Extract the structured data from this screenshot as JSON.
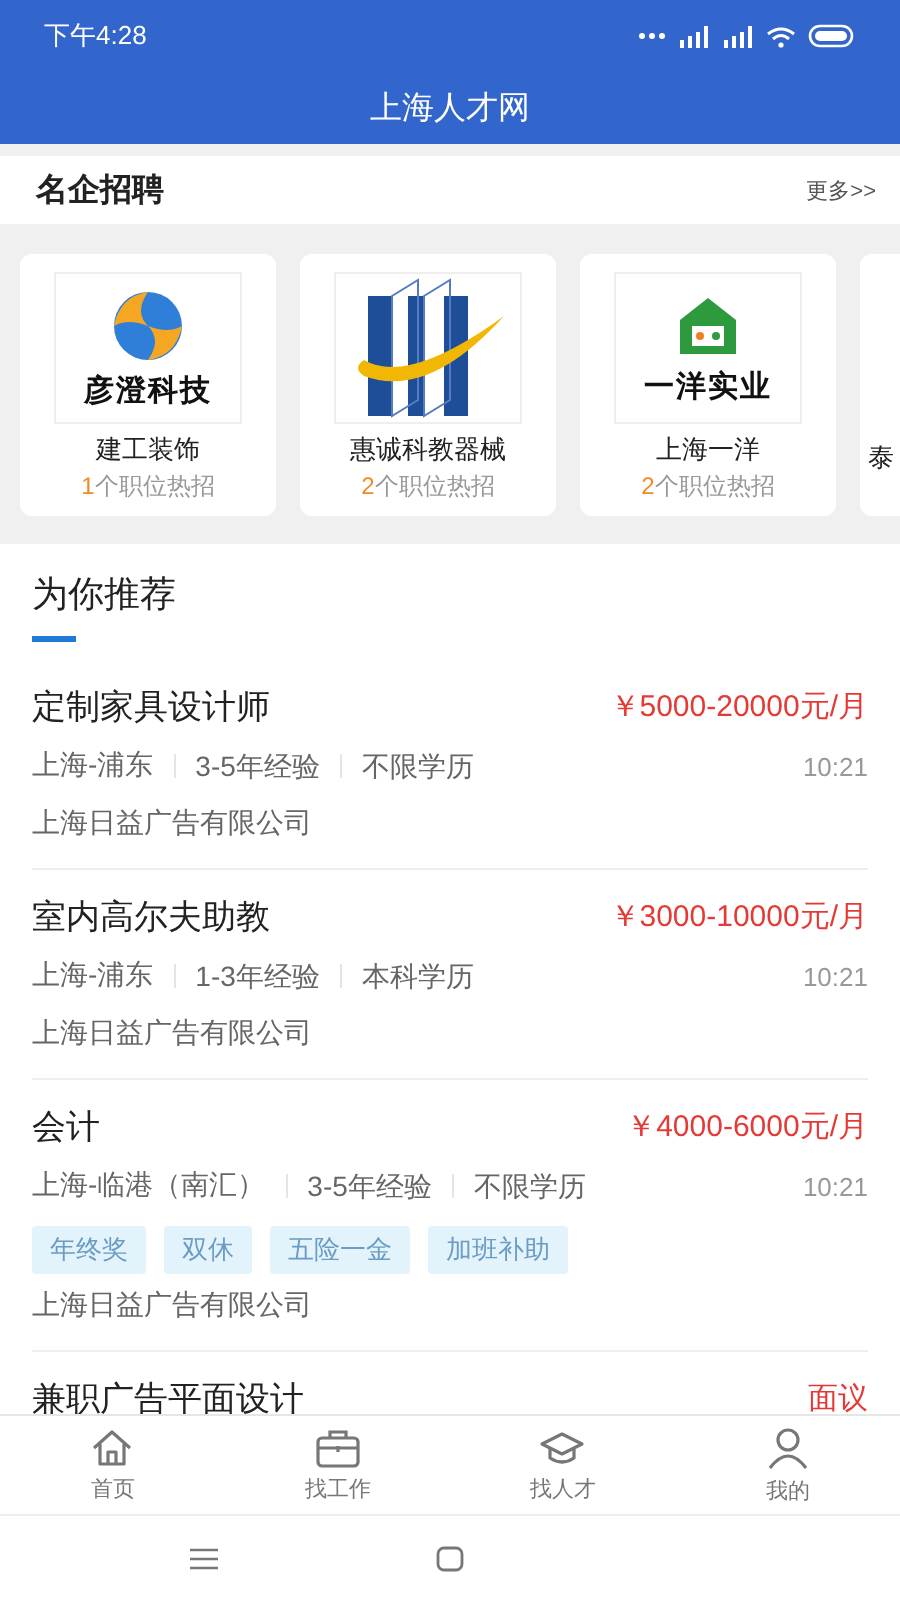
{
  "status_bar": {
    "time": "下午4:28"
  },
  "header": {
    "title": "上海人才网"
  },
  "featured": {
    "title": "名企招聘",
    "more": "更多>>",
    "companies": [
      {
        "kind": "swirl",
        "logo_text": "彦澄科技",
        "name": "建工装饰",
        "count": "1",
        "suffix": "个职位热招"
      },
      {
        "kind": "bars",
        "name": "惠诚科教器械",
        "count": "2",
        "suffix": "个职位热招"
      },
      {
        "kind": "house",
        "logo_text": "一洋实业",
        "name": "上海一洋",
        "count": "2",
        "suffix": "个职位热招"
      },
      {
        "kind": "partial",
        "name": "泰"
      }
    ]
  },
  "recommend": {
    "title": "为你推荐",
    "jobs": [
      {
        "title": "定制家具设计师",
        "salary": "￥5000-20000元/月",
        "location": "上海-浦东",
        "experience": "3-5年经验",
        "education": "不限学历",
        "time": "10:21",
        "company": "上海日益广告有限公司"
      },
      {
        "title": "室内高尔夫助教",
        "salary": "￥3000-10000元/月",
        "location": "上海-浦东",
        "experience": "1-3年经验",
        "education": "本科学历",
        "time": "10:21",
        "company": "上海日益广告有限公司"
      },
      {
        "title": "会计",
        "salary": "￥4000-6000元/月",
        "location": "上海-临港（南汇）",
        "experience": "3-5年经验",
        "education": "不限学历",
        "time": "10:21",
        "tags": [
          "年终奖",
          "双休",
          "五险一金",
          "加班补助"
        ],
        "company": "上海日益广告有限公司"
      },
      {
        "title": "兼职广告平面设计",
        "salary": "面议"
      }
    ]
  },
  "nav": [
    {
      "kind": "home",
      "label": "首页",
      "selected": false
    },
    {
      "kind": "briefcase",
      "label": "找工作",
      "selected": false
    },
    {
      "kind": "cap",
      "label": "找人才",
      "selected": false
    },
    {
      "kind": "person",
      "label": "我的",
      "selected": false
    }
  ]
}
